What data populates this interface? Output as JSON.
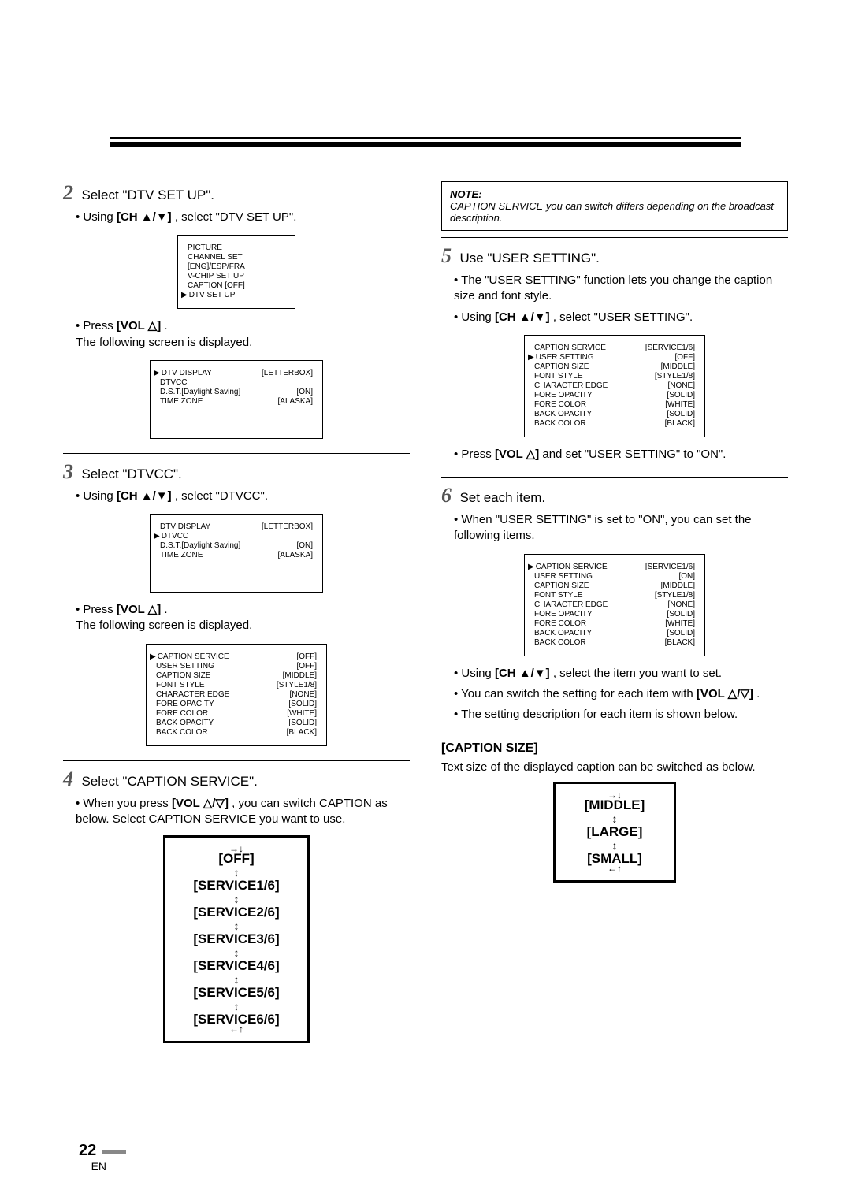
{
  "page_number": "22",
  "page_lang": "EN",
  "left": {
    "step2": {
      "num": "2",
      "title": "Select \"DTV SET UP\".",
      "b1_pre": "Using ",
      "b1_btn": "[CH ▲/▼]",
      "b1_post": ", select \"DTV SET UP\".",
      "osd1": {
        "l1": "PICTURE",
        "l2": "CHANNEL SET",
        "l3": "[ENG]/ESP/FRA",
        "l4": "V-CHIP SET UP",
        "l5": "CAPTION [OFF]",
        "l6": "DTV SET UP"
      },
      "b2_pre": "Press ",
      "b2_btn": "[VOL △]",
      "b2_post": ".",
      "b2_line2": "The following screen is displayed.",
      "osd2": {
        "r1k": "DTV DISPLAY",
        "r1v": "[LETTERBOX]",
        "r2k": "DTVCC",
        "r3k": "D.S.T.[Daylight Saving]",
        "r3v": "[ON]",
        "r4k": "TIME ZONE",
        "r4v": "[ALASKA]"
      }
    },
    "step3": {
      "num": "3",
      "title": "Select \"DTVCC\".",
      "b1_pre": "Using ",
      "b1_btn": "[CH ▲/▼]",
      "b1_post": ", select \"DTVCC\".",
      "osd1": {
        "r1k": "DTV DISPLAY",
        "r1v": "[LETTERBOX]",
        "r2k": "DTVCC",
        "r3k": "D.S.T.[Daylight Saving]",
        "r3v": "[ON]",
        "r4k": "TIME ZONE",
        "r4v": "[ALASKA]"
      },
      "b2_pre": "Press ",
      "b2_btn": "[VOL △]",
      "b2_post": ".",
      "b2_line2": "The following screen is displayed.",
      "osd2": {
        "r1k": "CAPTION SERVICE",
        "r1v": "[OFF]",
        "r2k": "USER SETTING",
        "r2v": "[OFF]",
        "r3k": "CAPTION SIZE",
        "r3v": "[MIDDLE]",
        "r4k": "FONT STYLE",
        "r4v": "[STYLE1/8]",
        "r5k": "CHARACTER EDGE",
        "r5v": "[NONE]",
        "r6k": "FORE OPACITY",
        "r6v": "[SOLID]",
        "r7k": "FORE COLOR",
        "r7v": "[WHITE]",
        "r8k": "BACK OPACITY",
        "r8v": "[SOLID]",
        "r9k": "BACK COLOR",
        "r9v": "[BLACK]"
      }
    },
    "step4": {
      "num": "4",
      "title": "Select \"CAPTION SERVICE\".",
      "b1_pre": "When you press ",
      "b1_btn": "[VOL △/▽]",
      "b1_post": ", you can switch CAPTION as below. Select CAPTION SERVICE you want to use.",
      "flow": [
        "[OFF]",
        "[SERVICE1/6]",
        "[SERVICE2/6]",
        "[SERVICE3/6]",
        "[SERVICE4/6]",
        "[SERVICE5/6]",
        "[SERVICE6/6]"
      ]
    }
  },
  "right": {
    "note_label": "NOTE:",
    "note_text": "CAPTION SERVICE you can switch differs depending on the broadcast description.",
    "step5": {
      "num": "5",
      "title": "Use \"USER SETTING\".",
      "b1": "The \"USER SETTING\" function lets you change the caption size and font style.",
      "b2_pre": "Using ",
      "b2_btn": "[CH ▲/▼]",
      "b2_post": ", select \"USER SETTING\".",
      "osd": {
        "r1k": "CAPTION SERVICE",
        "r1v": "[SERVICE1/6]",
        "r2k": "USER SETTING",
        "r2v": "[OFF]",
        "r3k": "CAPTION SIZE",
        "r3v": "[MIDDLE]",
        "r4k": "FONT STYLE",
        "r4v": "[STYLE1/8]",
        "r5k": "CHARACTER EDGE",
        "r5v": "[NONE]",
        "r6k": "FORE OPACITY",
        "r6v": "[SOLID]",
        "r7k": "FORE COLOR",
        "r7v": "[WHITE]",
        "r8k": "BACK OPACITY",
        "r8v": "[SOLID]",
        "r9k": "BACK COLOR",
        "r9v": "[BLACK]"
      },
      "b3_pre": "Press ",
      "b3_btn": "[VOL △]",
      "b3_post": " and set \"USER SETTING\" to \"ON\"."
    },
    "step6": {
      "num": "6",
      "title": "Set each item.",
      "b1": "When \"USER SETTING\" is set to \"ON\", you can set the following items.",
      "osd": {
        "r1k": "CAPTION SERVICE",
        "r1v": "[SERVICE1/6]",
        "r2k": "USER SETTING",
        "r2v": "[ON]",
        "r3k": "CAPTION SIZE",
        "r3v": "[MIDDLE]",
        "r4k": "FONT STYLE",
        "r4v": "[STYLE1/8]",
        "r5k": "CHARACTER EDGE",
        "r5v": "[NONE]",
        "r6k": "FORE OPACITY",
        "r6v": "[SOLID]",
        "r7k": "FORE COLOR",
        "r7v": "[WHITE]",
        "r8k": "BACK OPACITY",
        "r8v": "[SOLID]",
        "r9k": "BACK COLOR",
        "r9v": "[BLACK]"
      },
      "b2_pre": "Using ",
      "b2_btn": "[CH ▲/▼]",
      "b2_post": ", select the item you want to set.",
      "b3_pre": "You can switch the setting for each item with ",
      "b3_btn": "[VOL △/▽]",
      "b3_post": ".",
      "b4": "The setting description for each item is shown below."
    },
    "caption_size": {
      "head": "[CAPTION SIZE]",
      "text": "Text size of the displayed caption can be switched as below.",
      "flow": [
        "[MIDDLE]",
        "[LARGE]",
        "[SMALL]"
      ]
    }
  },
  "icons": {
    "ptr": "▶",
    "ud": "↕"
  }
}
